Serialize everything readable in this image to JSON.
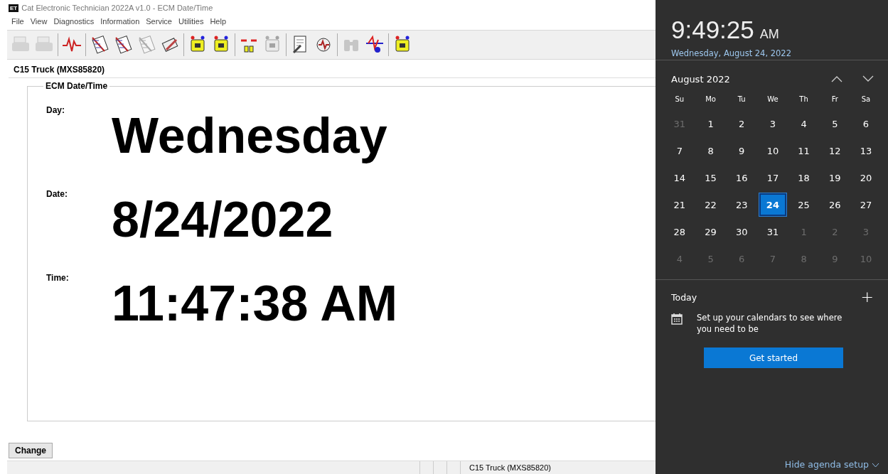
{
  "window": {
    "logo": "ET",
    "title": "Cat Electronic Technician 2022A v1.0 - ECM Date/Time"
  },
  "menu": [
    "File",
    "View",
    "Diagnostics",
    "Information",
    "Service",
    "Utilities",
    "Help"
  ],
  "toolbar": [
    [
      {
        "disabled": true
      },
      {
        "disabled": true
      }
    ],
    [
      {
        "disabled": false
      }
    ],
    [
      {
        "disabled": false
      },
      {
        "disabled": false
      },
      {
        "disabled": true
      },
      {
        "disabled": false
      }
    ],
    [
      {
        "disabled": false
      },
      {
        "disabled": false
      }
    ],
    [
      {
        "disabled": false
      },
      {
        "disabled": true
      }
    ],
    [
      {
        "disabled": false
      },
      {
        "disabled": false
      }
    ],
    [
      {
        "disabled": true
      },
      {
        "disabled": false
      }
    ],
    [
      {
        "disabled": false
      }
    ]
  ],
  "ecm": "C15 Truck (MXS85820)",
  "group_title": "ECM Date/Time",
  "fields": [
    {
      "label": "Day:",
      "value": "Wednesday"
    },
    {
      "label": "Date:",
      "value": "8/24/2022"
    },
    {
      "label": "Time:",
      "value": "11:47:38 AM"
    }
  ],
  "change_button": "Change",
  "status_bar": [
    "C15 Truck (MXS85820)"
  ],
  "clock": {
    "time": "9:49:25",
    "ampm": "AM",
    "date": "Wednesday, August 24, 2022"
  },
  "calendar": {
    "month": "August 2022",
    "weekdays": [
      "Su",
      "Mo",
      "Tu",
      "We",
      "Th",
      "Fr",
      "Sa"
    ],
    "weeks": [
      [
        {
          "label": "31",
          "in_month": false,
          "selected": false
        },
        {
          "label": "1",
          "in_month": true,
          "selected": false
        },
        {
          "label": "2",
          "in_month": true,
          "selected": false
        },
        {
          "label": "3",
          "in_month": true,
          "selected": false
        },
        {
          "label": "4",
          "in_month": true,
          "selected": false
        },
        {
          "label": "5",
          "in_month": true,
          "selected": false
        },
        {
          "label": "6",
          "in_month": true,
          "selected": false
        }
      ],
      [
        {
          "label": "7",
          "in_month": true,
          "selected": false
        },
        {
          "label": "8",
          "in_month": true,
          "selected": false
        },
        {
          "label": "9",
          "in_month": true,
          "selected": false
        },
        {
          "label": "10",
          "in_month": true,
          "selected": false
        },
        {
          "label": "11",
          "in_month": true,
          "selected": false
        },
        {
          "label": "12",
          "in_month": true,
          "selected": false
        },
        {
          "label": "13",
          "in_month": true,
          "selected": false
        }
      ],
      [
        {
          "label": "14",
          "in_month": true,
          "selected": false
        },
        {
          "label": "15",
          "in_month": true,
          "selected": false
        },
        {
          "label": "16",
          "in_month": true,
          "selected": false
        },
        {
          "label": "17",
          "in_month": true,
          "selected": false
        },
        {
          "label": "18",
          "in_month": true,
          "selected": false
        },
        {
          "label": "19",
          "in_month": true,
          "selected": false
        },
        {
          "label": "20",
          "in_month": true,
          "selected": false
        }
      ],
      [
        {
          "label": "21",
          "in_month": true,
          "selected": false
        },
        {
          "label": "22",
          "in_month": true,
          "selected": false
        },
        {
          "label": "23",
          "in_month": true,
          "selected": false
        },
        {
          "label": "24",
          "in_month": true,
          "selected": true
        },
        {
          "label": "25",
          "in_month": true,
          "selected": false
        },
        {
          "label": "26",
          "in_month": true,
          "selected": false
        },
        {
          "label": "27",
          "in_month": true,
          "selected": false
        }
      ],
      [
        {
          "label": "28",
          "in_month": true,
          "selected": false
        },
        {
          "label": "29",
          "in_month": true,
          "selected": false
        },
        {
          "label": "30",
          "in_month": true,
          "selected": false
        },
        {
          "label": "31",
          "in_month": true,
          "selected": false
        },
        {
          "label": "1",
          "in_month": false,
          "selected": false
        },
        {
          "label": "2",
          "in_month": false,
          "selected": false
        },
        {
          "label": "3",
          "in_month": false,
          "selected": false
        }
      ],
      [
        {
          "label": "4",
          "in_month": false,
          "selected": false
        },
        {
          "label": "5",
          "in_month": false,
          "selected": false
        },
        {
          "label": "6",
          "in_month": false,
          "selected": false
        },
        {
          "label": "7",
          "in_month": false,
          "selected": false
        },
        {
          "label": "8",
          "in_month": false,
          "selected": false
        },
        {
          "label": "9",
          "in_month": false,
          "selected": false
        },
        {
          "label": "10",
          "in_month": false,
          "selected": false
        }
      ]
    ]
  },
  "agenda": {
    "title": "Today",
    "add": "+",
    "message": "Set up your calendars to see where you need to be",
    "button": "Get started",
    "hide": "Hide agenda setup"
  }
}
